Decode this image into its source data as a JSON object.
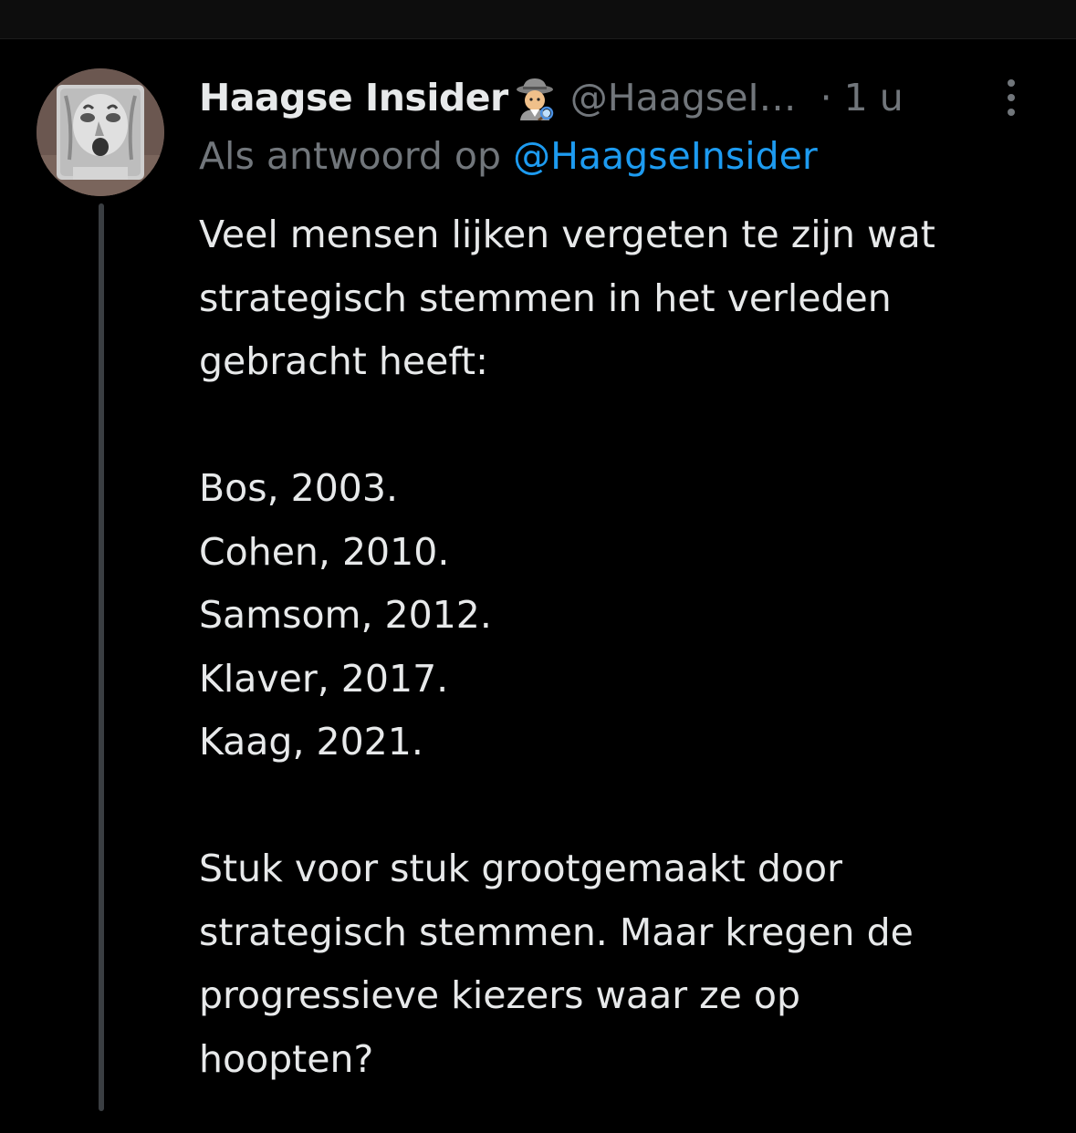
{
  "tweet": {
    "display_name": "Haagse Insider",
    "handle": "@HaagseI…",
    "time": "· 1 u",
    "reply_prefix": "Als antwoord op",
    "reply_mention": "@HaagseInsider",
    "body": {
      "intro_lines": [
        "Veel mensen lijken vergeten te zijn wat",
        "strategisch stemmen in het verleden",
        "gebracht heeft:"
      ],
      "list_items": [
        "Bos, 2003.",
        "Cohen, 2010.",
        "Samsom, 2012.",
        "Klaver, 2017.",
        "Kaag, 2021."
      ],
      "outro_lines": [
        "Stuk voor stuk grootgemaakt door",
        "strategisch stemmen. Maar kregen de",
        "progressieve kiezers waar ze op",
        "hoopten?"
      ]
    }
  },
  "icons": {
    "badge": "detective-emoji-icon",
    "menu": "more-vertical-icon",
    "avatar": "stone-face-avatar"
  },
  "colors": {
    "background": "#000000",
    "text": "#e7e9ea",
    "muted": "#71767b",
    "link": "#1d9bf0",
    "thread_line": "#3a3e42"
  }
}
